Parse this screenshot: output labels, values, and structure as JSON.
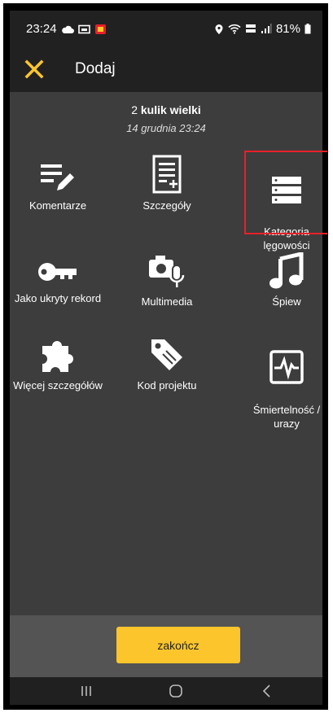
{
  "status": {
    "time": "23:24",
    "battery": "81%"
  },
  "toolbar": {
    "title": "Dodaj",
    "close_icon": "close-icon"
  },
  "record": {
    "count": "2",
    "species": "kulik wielki",
    "datetime": "14 grudnia 23:24"
  },
  "tiles": [
    {
      "label": "Komentarze",
      "icon": "comment-edit-icon"
    },
    {
      "label": "Szczegóły",
      "icon": "document-add-icon"
    },
    {
      "label": "Kategoria\nlęgowości",
      "icon": "list-icon"
    },
    {
      "label": "Jako ukryty rekord",
      "icon": "key-icon"
    },
    {
      "label": "Multimedia",
      "icon": "camera-mic-icon"
    },
    {
      "label": "Śpiew",
      "icon": "music-note-icon"
    },
    {
      "label": "Więcej szczegółów",
      "icon": "puzzle-icon"
    },
    {
      "label": "Kod projektu",
      "icon": "tag-icon"
    },
    {
      "label": "Śmiertelność /\nurazy",
      "icon": "pulse-icon"
    }
  ],
  "finish_label": "zakończ",
  "colors": {
    "accent": "#fcc52b",
    "highlight": "#e8202a",
    "background": "#3d3d3d",
    "toolbar": "#212121"
  }
}
